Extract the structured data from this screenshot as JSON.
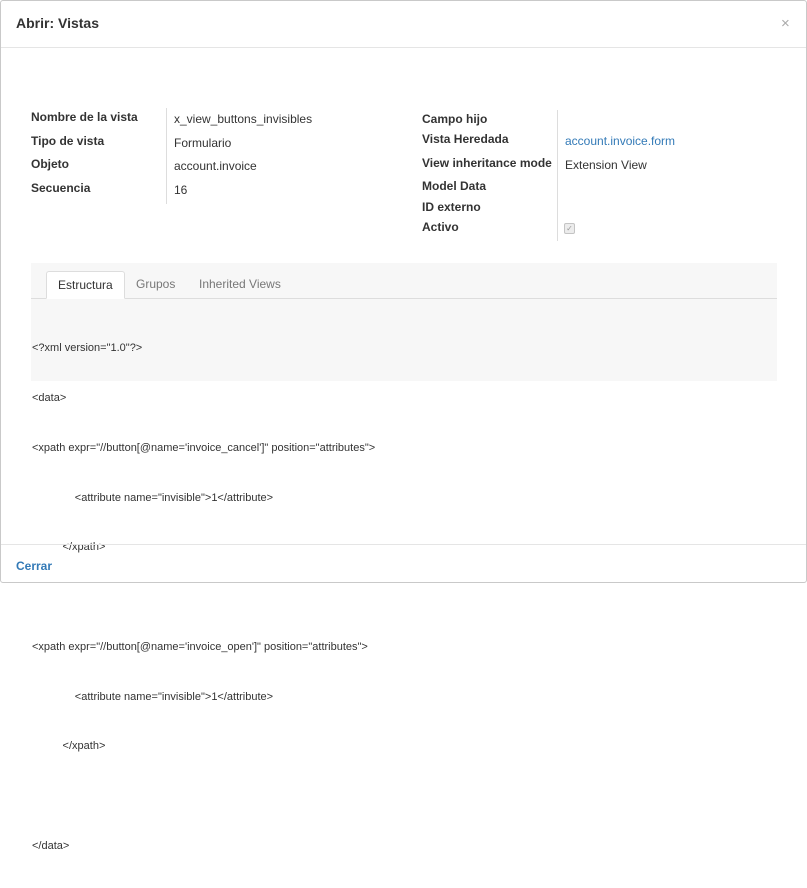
{
  "dialog": {
    "title": "Abrir: Vistas",
    "close_glyph": "×"
  },
  "left_fields": [
    {
      "label": "Nombre de la vista",
      "value": "x_view_buttons_invisibles"
    },
    {
      "label": "Tipo de vista",
      "value": "Formulario"
    },
    {
      "label": "Objeto",
      "value": "account.invoice"
    },
    {
      "label": "Secuencia",
      "value": "16"
    }
  ],
  "right_fields": [
    {
      "label": "Campo hijo",
      "value": ""
    },
    {
      "label": "Vista Heredada",
      "value": "account.invoice.form"
    },
    {
      "label": "View inheritance mode",
      "value": "Extension View"
    },
    {
      "label": "Model Data",
      "value": ""
    },
    {
      "label": "ID externo",
      "value": ""
    },
    {
      "label": "Activo",
      "checked": true
    }
  ],
  "tabs": [
    {
      "label": "Estructura",
      "active": true
    },
    {
      "label": "Grupos",
      "active": false
    },
    {
      "label": "Inherited Views",
      "active": false
    }
  ],
  "arch_lines": [
    "<?xml version=\"1.0\"?>",
    "<data>",
    "<xpath expr=\"//button[@name='invoice_cancel']\" position=\"attributes\">",
    "              <attribute name=\"invisible\">1</attribute>",
    "          </xpath>",
    "",
    "<xpath expr=\"//button[@name='invoice_open']\" position=\"attributes\">",
    "              <attribute name=\"invisible\">1</attribute>",
    "          </xpath>",
    "",
    "</data>"
  ],
  "footer": {
    "close_label": "Cerrar"
  },
  "colors": {
    "link": "#337ab7",
    "text": "#333333",
    "notebook_bg": "#f7f7f7"
  }
}
